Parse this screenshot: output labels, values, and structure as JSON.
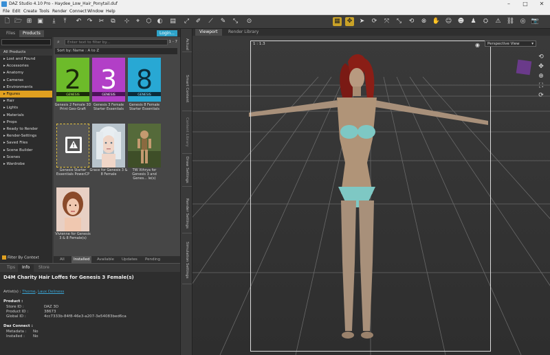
{
  "window": {
    "title": "DAZ Studio 4.10 Pro - Haydee_Low_Hair_Ponytail.duf"
  },
  "menu": [
    "File",
    "Edit",
    "Create",
    "Tools",
    "Render",
    "Connect",
    "Window",
    "Help"
  ],
  "left": {
    "tabs": [
      "Files",
      "Products"
    ],
    "login": "Login...",
    "categories_root": "All Products",
    "categories": [
      "Lost and Found",
      "Accessories",
      "Anatomy",
      "Cameras",
      "Environments",
      "Figures",
      "Hair",
      "Lights",
      "Materials",
      "Props",
      "Ready to Render",
      "Render-Settings",
      "Saved Files",
      "Scene Builder",
      "Scenes",
      "Wardrobe"
    ],
    "selected_category": "Figures",
    "search_placeholder": "Enter text to filter by...",
    "counter": "1 - 7",
    "sort": "Sort by: Name : A to Z",
    "filter_by_context": "Filter By Context",
    "products": [
      {
        "caption": "Genesis 2 Female 3D Print Geo-Graft"
      },
      {
        "caption": "Genesis 3 Female Starter Essentials"
      },
      {
        "caption": "Genesis 8 Female Starter Essentials"
      },
      {
        "caption": "Genesis Starter Essentials PowerCP"
      },
      {
        "caption": "Grace for Genesis 3 & 8 Female"
      },
      {
        "caption": "TW Xthrya for Genesis 3 and Genes... le(s)"
      },
      {
        "caption": "Vivienne for Genesis 3 & 8 Female(s)"
      }
    ],
    "grid_tabs": [
      "All",
      "Installed",
      "Available",
      "Updates",
      "Pending"
    ],
    "active_grid_tab": "Installed"
  },
  "info": {
    "tabs": [
      "Tips",
      "Info",
      "Store"
    ],
    "active_tab": "Info",
    "title": "D4M Charity Hair Loffes for Genesis 3 Female(s)",
    "artists_label": "Artist(s) :",
    "artists": [
      "Thorne",
      "Laux Deliness"
    ],
    "product_header": "Product :",
    "store_label": "Store ID :",
    "store": "DAZ 3D",
    "product_id_label": "Product ID :",
    "product_id": "38673",
    "global_id_label": "Global ID :",
    "global_id": "4cc7333b-84f8-46e3-a207-3e54083bed6ca",
    "connect_header": "Daz Connect :",
    "metadata_label": "Metadata :",
    "metadata": "No",
    "installed_label": "Installed :",
    "installed": "No"
  },
  "sidetabs": [
    "Actual",
    "Smart Content",
    "Content Library",
    "Draw Settings",
    "Render Settings",
    "Simulation Settings"
  ],
  "viewport": {
    "tabs": [
      "Viewport",
      "Render Library"
    ],
    "active_tab": "Viewport",
    "ratio": "1 : 1.3",
    "camera": "Perspective View"
  }
}
